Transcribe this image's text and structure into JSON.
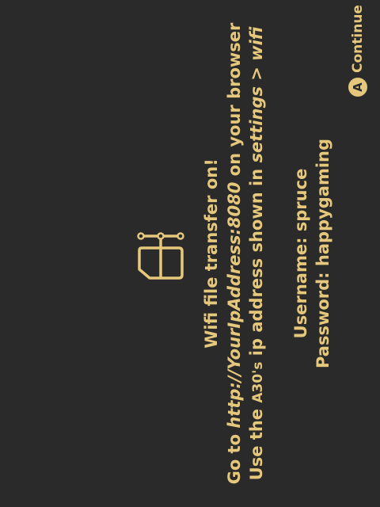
{
  "colors": {
    "background": "#2a2a2a",
    "accent": "#e6c87c"
  },
  "icon": "sd-card-network-icon",
  "message": {
    "title": "Wifi file transfer on!",
    "goto_prefix": "Go to ",
    "goto_url": "http://YourIpAddress:8080",
    "goto_suffix": " on your browser",
    "use_prefix": "Use the ",
    "device": "A30's",
    "use_middle": " ip address shown in ",
    "settings_path": "settings > wifi",
    "username_line": "Username: spruce",
    "password_line": "Password: happygaming"
  },
  "footer": {
    "button_glyph": "A",
    "continue_label": "Continue"
  }
}
